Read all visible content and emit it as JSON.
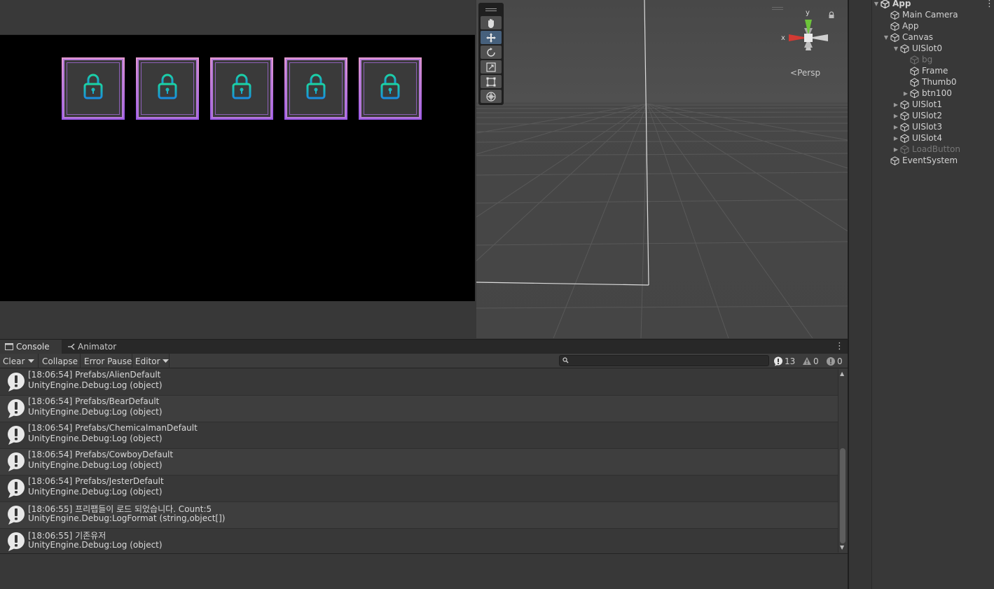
{
  "game_view": {
    "slots": [
      {
        "name": "slot-0",
        "icon": "lock-icon"
      },
      {
        "name": "slot-1",
        "icon": "lock-icon"
      },
      {
        "name": "slot-2",
        "icon": "lock-icon"
      },
      {
        "name": "slot-3",
        "icon": "lock-icon"
      },
      {
        "name": "slot-4",
        "icon": "lock-icon"
      }
    ],
    "colors": {
      "frame_top": "#e59ad0",
      "frame_bottom": "#9a58e6",
      "lock_top": "#1bd4a4",
      "lock_bottom": "#1a8de0"
    }
  },
  "scene_view": {
    "tools": [
      "hand-tool-icon",
      "move-tool-icon",
      "rotate-tool-icon",
      "scale-tool-icon",
      "rect-tool-icon",
      "transform-tool-icon"
    ],
    "active_tool": "move-tool-icon",
    "gizmo": {
      "x_label": "x",
      "y_label": "y"
    },
    "projection_label": "Persp"
  },
  "hierarchy": {
    "items": [
      {
        "label": "App",
        "indent": 0,
        "arrow": "▼",
        "dim": false,
        "bold": true
      },
      {
        "label": "Main Camera",
        "indent": 1,
        "arrow": "",
        "dim": false
      },
      {
        "label": "App",
        "indent": 1,
        "arrow": "",
        "dim": false
      },
      {
        "label": "Canvas",
        "indent": 1,
        "arrow": "▼",
        "dim": false
      },
      {
        "label": "UISlot0",
        "indent": 2,
        "arrow": "▼",
        "dim": false
      },
      {
        "label": "bg",
        "indent": 3,
        "arrow": "",
        "dim": true
      },
      {
        "label": "Frame",
        "indent": 3,
        "arrow": "",
        "dim": false
      },
      {
        "label": "Thumb0",
        "indent": 3,
        "arrow": "",
        "dim": false
      },
      {
        "label": "btn100",
        "indent": 3,
        "arrow": "▶",
        "dim": false
      },
      {
        "label": "UISlot1",
        "indent": 2,
        "arrow": "▶",
        "dim": false
      },
      {
        "label": "UISlot2",
        "indent": 2,
        "arrow": "▶",
        "dim": false
      },
      {
        "label": "UISlot3",
        "indent": 2,
        "arrow": "▶",
        "dim": false
      },
      {
        "label": "UISlot4",
        "indent": 2,
        "arrow": "▶",
        "dim": false
      },
      {
        "label": "LoadButton",
        "indent": 2,
        "arrow": "▶",
        "dim": true
      },
      {
        "label": "EventSystem",
        "indent": 1,
        "arrow": "",
        "dim": false
      }
    ]
  },
  "console": {
    "tabs": [
      {
        "label": "Console",
        "icon": "console-icon",
        "active": true
      },
      {
        "label": "Animator",
        "icon": "animator-icon",
        "active": false
      }
    ],
    "toolbar": {
      "clear_label": "Clear",
      "collapse_label": "Collapse",
      "error_pause_label": "Error Pause",
      "editor_label": "Editor",
      "search_value": "",
      "log_count": "13",
      "warning_count": "0",
      "error_count": "0"
    },
    "entries": [
      {
        "line1": "[18:06:54] Prefabs/AlienDefault",
        "line2": "UnityEngine.Debug:Log (object)"
      },
      {
        "line1": "[18:06:54] Prefabs/BearDefault",
        "line2": "UnityEngine.Debug:Log (object)"
      },
      {
        "line1": "[18:06:54] Prefabs/ChemicalmanDefault",
        "line2": "UnityEngine.Debug:Log (object)"
      },
      {
        "line1": "[18:06:54] Prefabs/CowboyDefault",
        "line2": "UnityEngine.Debug:Log (object)"
      },
      {
        "line1": "[18:06:54] Prefabs/JesterDefault",
        "line2": "UnityEngine.Debug:Log (object)"
      },
      {
        "line1": "[18:06:55] 프리팹들이 로드 되었습니다. Count:5",
        "line2": "UnityEngine.Debug:LogFormat (string,object[])"
      },
      {
        "line1": "[18:06:55] 기존유저",
        "line2": "UnityEngine.Debug:Log (object)"
      }
    ]
  }
}
